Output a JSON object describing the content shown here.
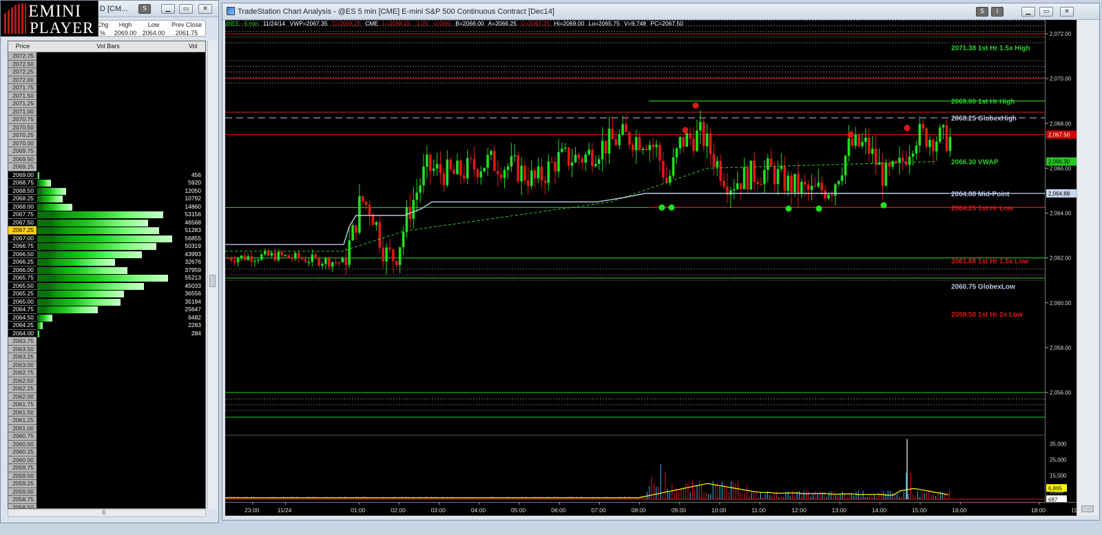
{
  "logo": {
    "line1": "EMINI",
    "line2": "PLAYER"
  },
  "ladder_window": {
    "title_partial": "D [CM...",
    "quote_headers": [
      "Chg",
      "High",
      "Low",
      "Prev Close"
    ],
    "quote_values": [
      "",
      "2069.00",
      "2064.00",
      "2061.75"
    ],
    "quote_marker": "%",
    "columns": {
      "price": "Price",
      "bars": "Vol Bars",
      "vol": "Vol"
    },
    "last_price": "2067.25",
    "rows": [
      {
        "price": "2072.75",
        "vol": ""
      },
      {
        "price": "2072.50",
        "vol": ""
      },
      {
        "price": "2072.25",
        "vol": ""
      },
      {
        "price": "2072.00",
        "vol": ""
      },
      {
        "price": "2071.75",
        "vol": ""
      },
      {
        "price": "2071.50",
        "vol": ""
      },
      {
        "price": "2071.25",
        "vol": ""
      },
      {
        "price": "2071.00",
        "vol": ""
      },
      {
        "price": "2070.75",
        "vol": ""
      },
      {
        "price": "2070.50",
        "vol": ""
      },
      {
        "price": "2070.25",
        "vol": ""
      },
      {
        "price": "2070.00",
        "vol": ""
      },
      {
        "price": "2069.75",
        "vol": ""
      },
      {
        "price": "2069.50",
        "vol": ""
      },
      {
        "price": "2069.25",
        "vol": ""
      },
      {
        "price": "2069.00",
        "vol": "456"
      },
      {
        "price": "2068.75",
        "vol": "5920"
      },
      {
        "price": "2068.50",
        "vol": "12050"
      },
      {
        "price": "2068.25",
        "vol": "10792"
      },
      {
        "price": "2068.00",
        "vol": "14860"
      },
      {
        "price": "2067.75",
        "vol": "53156"
      },
      {
        "price": "2067.50",
        "vol": "46568"
      },
      {
        "price": "2067.25",
        "vol": "51283"
      },
      {
        "price": "2067.00",
        "vol": "56855"
      },
      {
        "price": "2066.75",
        "vol": "50319"
      },
      {
        "price": "2066.50",
        "vol": "43993"
      },
      {
        "price": "2066.25",
        "vol": "32676"
      },
      {
        "price": "2066.00",
        "vol": "37959"
      },
      {
        "price": "2065.75",
        "vol": "55213"
      },
      {
        "price": "2065.50",
        "vol": "45033"
      },
      {
        "price": "2065.25",
        "vol": "36556"
      },
      {
        "price": "2065.00",
        "vol": "35194"
      },
      {
        "price": "2064.75",
        "vol": "25647"
      },
      {
        "price": "2064.50",
        "vol": "6482"
      },
      {
        "price": "2064.25",
        "vol": "2283"
      },
      {
        "price": "2064.00",
        "vol": "284"
      },
      {
        "price": "2063.75",
        "vol": ""
      },
      {
        "price": "2063.50",
        "vol": ""
      },
      {
        "price": "2063.25",
        "vol": ""
      },
      {
        "price": "2063.00",
        "vol": ""
      },
      {
        "price": "2062.75",
        "vol": ""
      },
      {
        "price": "2062.50",
        "vol": ""
      },
      {
        "price": "2062.25",
        "vol": ""
      },
      {
        "price": "2062.00",
        "vol": ""
      },
      {
        "price": "2061.75",
        "vol": ""
      },
      {
        "price": "2061.50",
        "vol": ""
      },
      {
        "price": "2061.25",
        "vol": ""
      },
      {
        "price": "2061.00",
        "vol": ""
      },
      {
        "price": "2060.75",
        "vol": ""
      },
      {
        "price": "2060.50",
        "vol": ""
      },
      {
        "price": "2060.25",
        "vol": ""
      },
      {
        "price": "2060.00",
        "vol": ""
      },
      {
        "price": "2059.75",
        "vol": ""
      },
      {
        "price": "2059.50",
        "vol": ""
      },
      {
        "price": "2059.25",
        "vol": ""
      },
      {
        "price": "2059.00",
        "vol": ""
      },
      {
        "price": "2058.75",
        "vol": ""
      },
      {
        "price": "2058.50",
        "vol": ""
      }
    ],
    "colors": {
      "price_bg": "#b8b8b8",
      "active_price_bg": "#000000",
      "last_bg": "#ffd200",
      "bar_dark": "#0c6e0c",
      "bar_mid": "#1ec81e",
      "bar_light": "#c8ffc8"
    }
  },
  "chart_window": {
    "title": "TradeStation Chart Analysis - @ES 5 min [CME] E-mini S&P 500 Continuous Contract [Dec14]",
    "status": {
      "symbol": "@ES - 5 min",
      "date": "11/24/14",
      "vwp": "VWP=2067.35",
      "c1": "C=2066.25",
      "ex": "CME",
      "l": "L=2066.25",
      "chg": "-1.25",
      "pct": "-0.06%",
      "b": "B=2066.00",
      "a": "A=2066.25",
      "c2": "C=2067.25",
      "hi": "Hi=2069.00",
      "lo": "Lo=2065.75",
      "v": "V=9,748",
      "pc": "PC=2067.50"
    },
    "price_ticks": [
      "2,072.00",
      "2,070.00",
      "2,068.00",
      "2,066.00",
      "2,064.00",
      "2,062.00",
      "2,060.00",
      "2,058.00",
      "2,056.00"
    ],
    "price_flags": [
      {
        "text": "2,067.50",
        "price": 2067.5,
        "bg": "#d40000",
        "fg": "#ffffff"
      },
      {
        "text": "2,066.30",
        "price": 2066.3,
        "bg": "#22c922",
        "fg": "#000000"
      },
      {
        "text": "2,064.88",
        "price": 2064.88,
        "bg": "#c9d8f0",
        "fg": "#000000"
      }
    ],
    "volume_ticks": [
      "35,000",
      "25,000",
      "15,000",
      "5,000"
    ],
    "volume_flags": [
      {
        "text": "6,865",
        "value": 6865,
        "bg": "#ffff00"
      },
      {
        "text": "687",
        "value": 687,
        "bg": "#ffffff"
      }
    ],
    "time_ticks": [
      "23:00",
      "11/24",
      "01:00",
      "02:00",
      "03:00",
      "04:00",
      "05:00",
      "06:00",
      "07:00",
      "08:00",
      "09:00",
      "10:00",
      "11:00",
      "12:00",
      "13:00",
      "14:00",
      "15:00",
      "16:00",
      "18:00",
      "19:00"
    ],
    "levels": [
      {
        "label": "2071.38 1st Hr  1.5x High",
        "price": 2071.38,
        "color": "#28d428",
        "label_color": "#28d428"
      },
      {
        "label": "2069.00 1st Hr  High",
        "price": 2069.0,
        "color": "#28d428",
        "label_color": "#28d428"
      },
      {
        "label": "2068.25 GlobexHigh",
        "price": 2068.25,
        "color": "#b9c8e8",
        "label_color": "#b9c8e8"
      },
      {
        "label": "2066.30 VWAP",
        "price": 2066.3,
        "color": "#28d428",
        "label_color": "#28d428"
      },
      {
        "label": "2064.88 Mid-Point",
        "price": 2064.88,
        "color": "#b9c8e8",
        "label_color": "#b9c8e8"
      },
      {
        "label": "2064.25 1st Hr  Low",
        "price": 2064.25,
        "color": "#e01818",
        "label_color": "#e01818"
      },
      {
        "label": "2061.88 1st Hr  1.5x Low",
        "price": 2061.88,
        "color": "#e01818",
        "label_color": "#e01818"
      },
      {
        "label": "2060.75 GlobexLow",
        "price": 2060.75,
        "color": "#b9c8e8",
        "label_color": "#b9c8e8"
      },
      {
        "label": "2059.50 1st Hr  2x Low",
        "price": 2059.5,
        "color": "#e01818",
        "label_color": "#e01818"
      }
    ],
    "colors": {
      "up": "#1ee01e",
      "down": "#e01818",
      "vwap": "#28d428",
      "midpoint": "#c9d8f0",
      "volume_avg": "#ffff00"
    }
  }
}
